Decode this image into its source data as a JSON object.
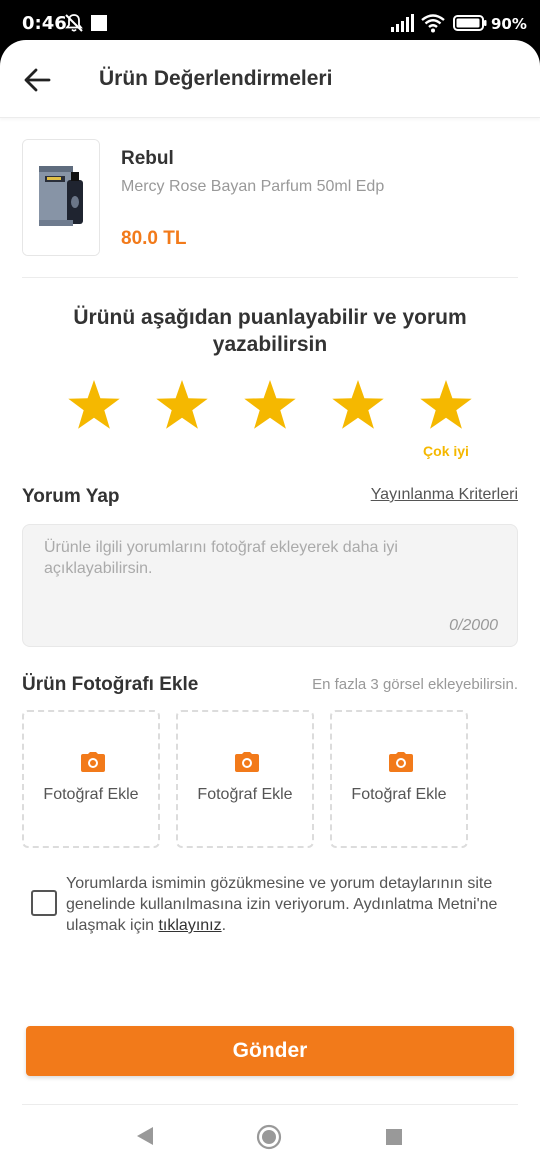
{
  "status_bar": {
    "time": "0:46",
    "battery": "90%"
  },
  "header": {
    "title": "Ürün Değerlendirmeleri",
    "back_icon": "arrow-left-icon"
  },
  "product": {
    "brand": "Rebul",
    "name": "Mercy Rose Bayan Parfum 50ml Edp",
    "price": "80.0 TL"
  },
  "rating": {
    "title": "Ürünü aşağıdan puanlayabilir ve yorum yazabilirsin",
    "value": 5,
    "max": 5,
    "caption": "Çok iyi",
    "star_color": "#F5B800"
  },
  "comment": {
    "label": "Yorum Yap",
    "criteria_link": "Yayınlanma Kriterleri",
    "placeholder": "Ürünle ilgili yorumlarını fotoğraf ekleyerek daha iyi açıklayabilirsin.",
    "counter": "0/2000"
  },
  "photos": {
    "label": "Ürün Fotoğrafı Ekle",
    "hint": "En fazla 3 görsel ekleyebilirsin.",
    "slots": [
      {
        "label": "Fotoğraf Ekle",
        "icon": "camera-icon"
      },
      {
        "label": "Fotoğraf Ekle",
        "icon": "camera-icon"
      },
      {
        "label": "Fotoğraf Ekle",
        "icon": "camera-icon"
      }
    ]
  },
  "consent": {
    "checked": false,
    "text": "Yorumlarda ismimin gözükmesine ve yorum detaylarının site genelinde kullanılmasına izin veriyorum. Aydınlatma Metni'ne ulaşmak için ",
    "link": "tıklayınız",
    "suffix": "."
  },
  "submit": {
    "label": "Gönder"
  },
  "colors": {
    "accent": "#F27A1A",
    "star": "#F5B800",
    "text": "#333333",
    "muted": "#999999"
  }
}
